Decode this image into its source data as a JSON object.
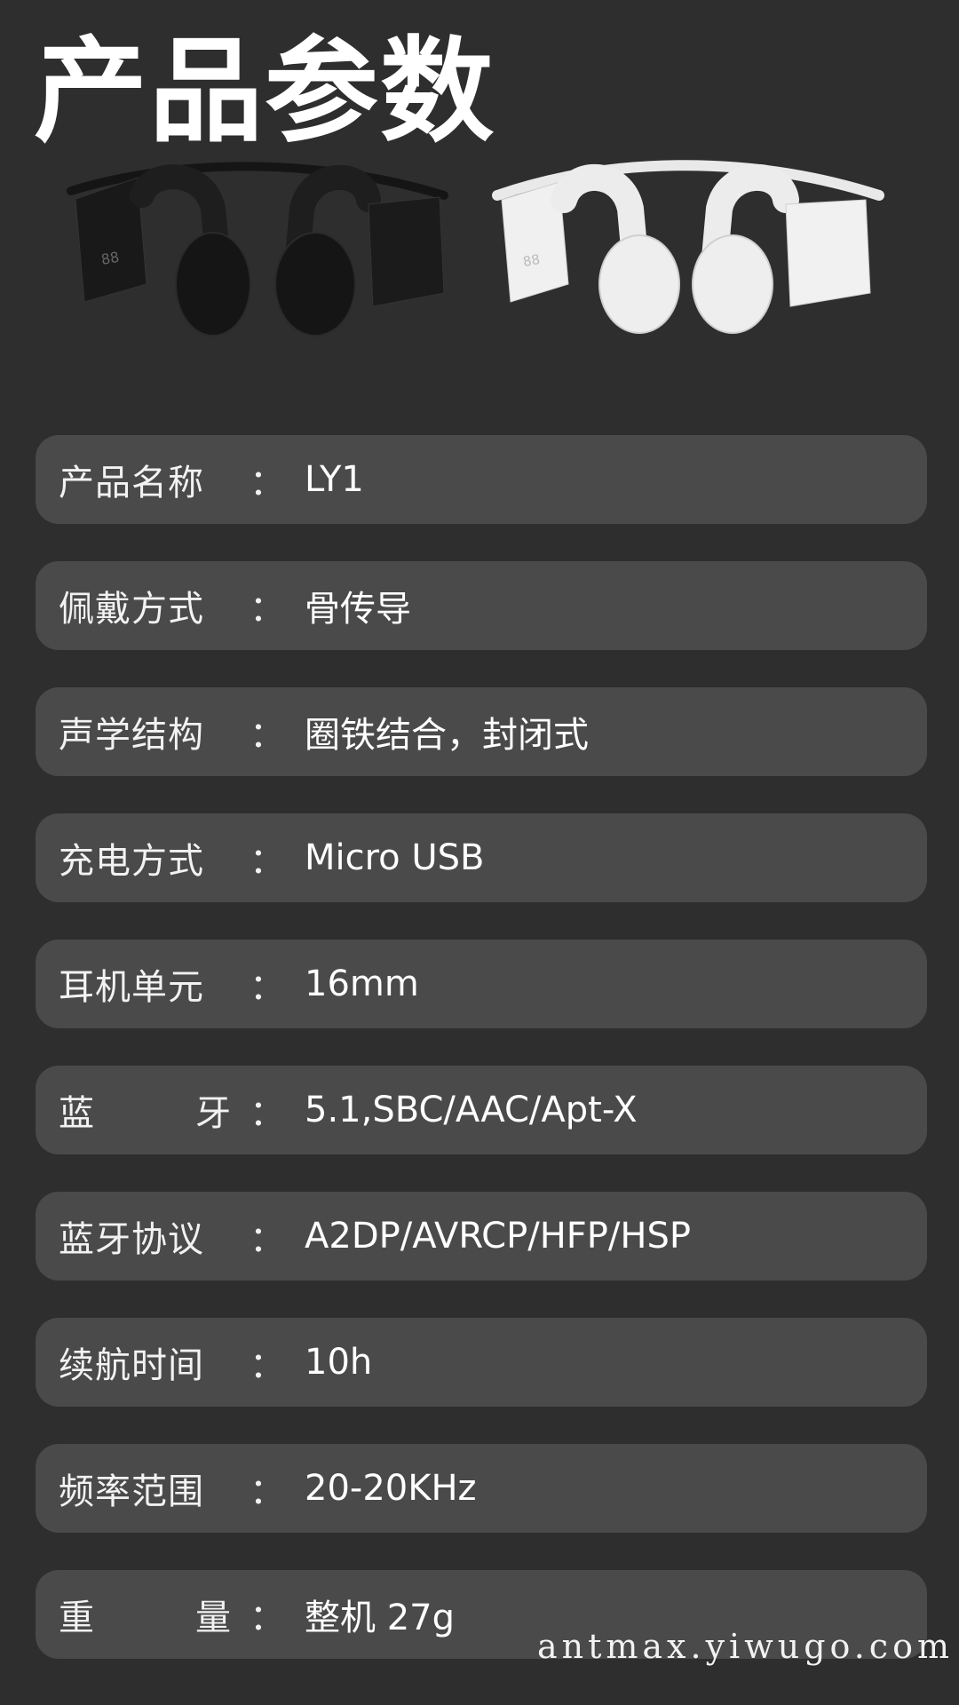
{
  "title": "产品参数",
  "products": {
    "variants": [
      "black-headphones",
      "white-headphones"
    ],
    "colors": {
      "black": "#202020",
      "white": "#f1f1f1"
    }
  },
  "specs": [
    {
      "label": "产品名称",
      "colon": "：",
      "value": "LY1",
      "spread": false
    },
    {
      "label": "佩戴方式",
      "colon": "：",
      "value": "骨传导",
      "spread": false
    },
    {
      "label": "声学结构",
      "colon": "：",
      "value": "圈铁结合，封闭式",
      "spread": false
    },
    {
      "label": "充电方式",
      "colon": "：",
      "value": "Micro USB",
      "spread": false
    },
    {
      "label": "耳机单元",
      "colon": "：",
      "value": "16mm",
      "spread": false
    },
    {
      "label": "蓝牙",
      "colon": "：",
      "value": "5.1,SBC/AAC/Apt-X",
      "spread": true
    },
    {
      "label": "蓝牙协议",
      "colon": "：",
      "value": "A2DP/AVRCP/HFP/HSP",
      "spread": false
    },
    {
      "label": "续航时间",
      "colon": "：",
      "value": "10h",
      "spread": false
    },
    {
      "label": "频率范围",
      "colon": "：",
      "value": "20-20KHz",
      "spread": false
    },
    {
      "label": "重量",
      "colon": "：",
      "value": "整机 27g",
      "spread": true
    }
  ],
  "watermark": "antmax.yiwugo.com"
}
